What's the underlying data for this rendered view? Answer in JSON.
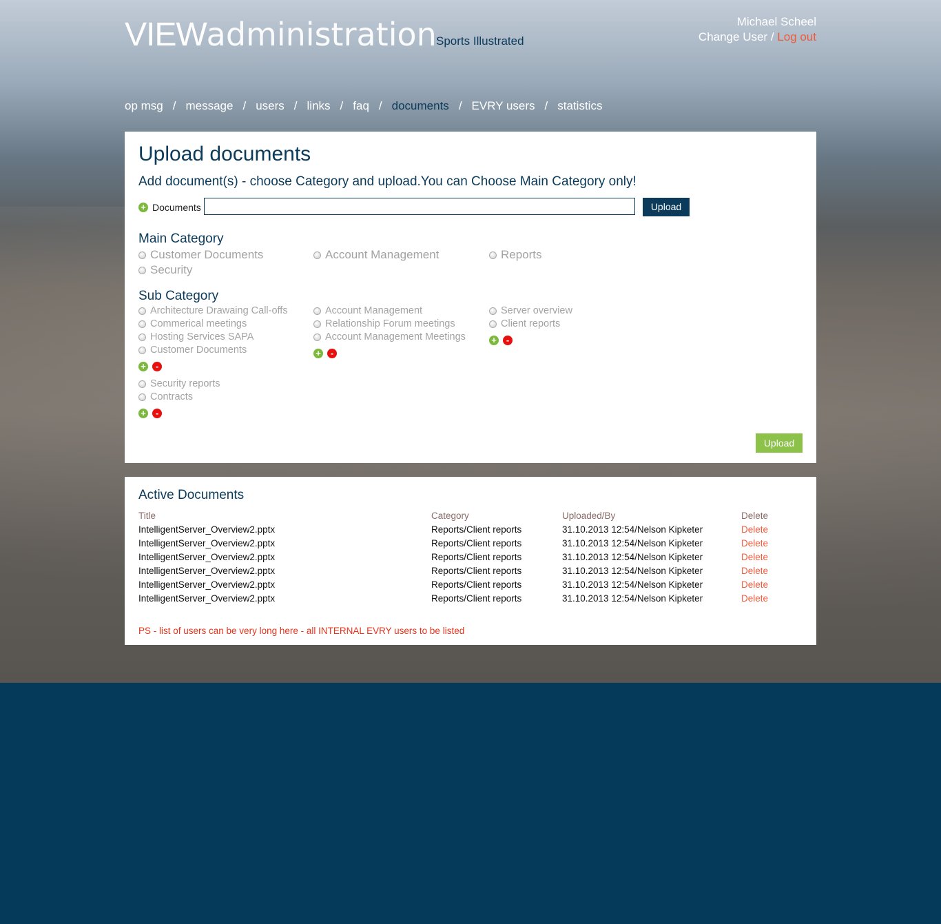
{
  "header": {
    "logo_bold": "VIEW",
    "logo_light": "administration",
    "client": "Sports Illustrated",
    "user_name": "Michael Scheel",
    "change_user": "Change User",
    "separator": " / ",
    "logout": "Log out"
  },
  "nav": {
    "items": [
      {
        "label": "op msg"
      },
      {
        "label": "message"
      },
      {
        "label": "users"
      },
      {
        "label": "links"
      },
      {
        "label": "faq"
      },
      {
        "label": "documents",
        "active": true
      },
      {
        "label": "EVRY users"
      },
      {
        "label": "statistics"
      }
    ],
    "separator": "/"
  },
  "upload": {
    "title": "Upload documents",
    "subtitle": "Add document(s) - choose Category and upload.You can Choose Main Category only!",
    "documents_label": "Documents",
    "documents_value": "",
    "upload_button": "Upload",
    "main_category_title": "Main Category",
    "main_categories": [
      "Customer Documents",
      "Account Management",
      "Reports",
      "Security"
    ],
    "sub_category_title": "Sub Category",
    "sub_col1": [
      "Architecture Drawaing Call-offs",
      "Commerical meetings",
      "Hosting Services SAPA",
      "Customer Documents"
    ],
    "sub_col1b": [
      "Security reports",
      "Contracts"
    ],
    "sub_col2": [
      "Account Management",
      "Relationship Forum meetings",
      "Account Management Meetings"
    ],
    "sub_col3": [
      "Server overview",
      "Client reports"
    ],
    "plus_symbol": "+",
    "minus_symbol": "-",
    "submit_button": "Upload"
  },
  "active_docs": {
    "title": "Active Documents",
    "columns": {
      "title": "Title",
      "category": "Category",
      "uploaded": "Uploaded/By",
      "delete": "Delete"
    },
    "rows": [
      {
        "title": "IntelligentServer_Overview2.pptx",
        "category": "Reports/Client reports",
        "uploaded": "31.10.2013 12:54/Nelson Kipketer",
        "delete": "Delete"
      },
      {
        "title": "IntelligentServer_Overview2.pptx",
        "category": "Reports/Client reports",
        "uploaded": "31.10.2013 12:54/Nelson Kipketer",
        "delete": "Delete"
      },
      {
        "title": "IntelligentServer_Overview2.pptx",
        "category": "Reports/Client reports",
        "uploaded": "31.10.2013 12:54/Nelson Kipketer",
        "delete": "Delete"
      },
      {
        "title": "IntelligentServer_Overview2.pptx",
        "category": "Reports/Client reports",
        "uploaded": "31.10.2013 12:54/Nelson Kipketer",
        "delete": "Delete"
      },
      {
        "title": "IntelligentServer_Overview2.pptx",
        "category": "Reports/Client reports",
        "uploaded": "31.10.2013 12:54/Nelson Kipketer",
        "delete": "Delete"
      },
      {
        "title": "IntelligentServer_Overview2.pptx",
        "category": "Reports/Client reports",
        "uploaded": "31.10.2013 12:54/Nelson Kipketer",
        "delete": "Delete"
      }
    ],
    "note": "PS - list of users can be very long here - all INTERNAL EVRY users to be listed"
  },
  "colors": {
    "brand_navy": "#0b3a5a",
    "accent_green": "#8cc24a",
    "danger_red": "#e8100f",
    "link_orange": "#f05a3c",
    "footer_bg": "#063a5a"
  }
}
